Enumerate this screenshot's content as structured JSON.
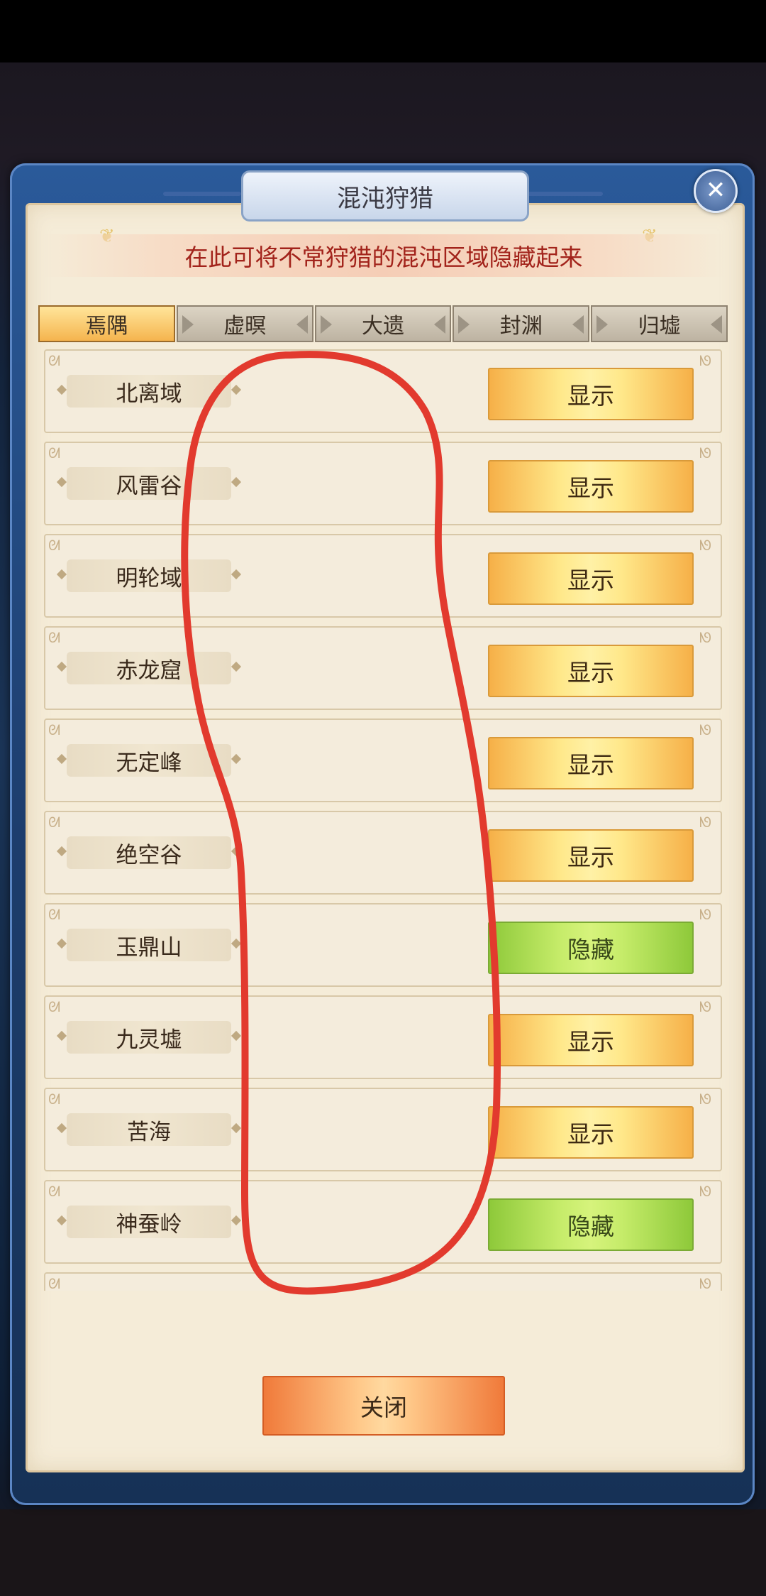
{
  "window": {
    "title": "混沌狩猎"
  },
  "banner": {
    "text": "在此可将不常狩猎的混沌区域隐藏起来"
  },
  "tabs": [
    {
      "label": "焉隅",
      "active": true
    },
    {
      "label": "虚暝",
      "active": false
    },
    {
      "label": "大遗",
      "active": false
    },
    {
      "label": "封渊",
      "active": false
    },
    {
      "label": "归墟",
      "active": false
    }
  ],
  "regions": [
    {
      "name": "北离域",
      "action": "显示",
      "state": "show"
    },
    {
      "name": "风雷谷",
      "action": "显示",
      "state": "show"
    },
    {
      "name": "明轮域",
      "action": "显示",
      "state": "show"
    },
    {
      "name": "赤龙窟",
      "action": "显示",
      "state": "show"
    },
    {
      "name": "无定峰",
      "action": "显示",
      "state": "show"
    },
    {
      "name": "绝空谷",
      "action": "显示",
      "state": "show"
    },
    {
      "name": "玉鼎山",
      "action": "隐藏",
      "state": "hide"
    },
    {
      "name": "九灵墟",
      "action": "显示",
      "state": "show"
    },
    {
      "name": "苦海",
      "action": "显示",
      "state": "show"
    },
    {
      "name": "神蚕岭",
      "action": "隐藏",
      "state": "hide"
    },
    {
      "name": "",
      "action": "",
      "state": "hide"
    }
  ],
  "footer": {
    "close_label": "关闭"
  },
  "icons": {
    "close": "close-x-icon",
    "tab_arrow": "arrow-icon",
    "row_corner": "corner-ornament-icon"
  },
  "colors": {
    "title_red": "#a2231b",
    "show_button": "#ffe88a",
    "hide_button": "#c6ec6a",
    "annotation_stroke": "#e23a2e"
  }
}
